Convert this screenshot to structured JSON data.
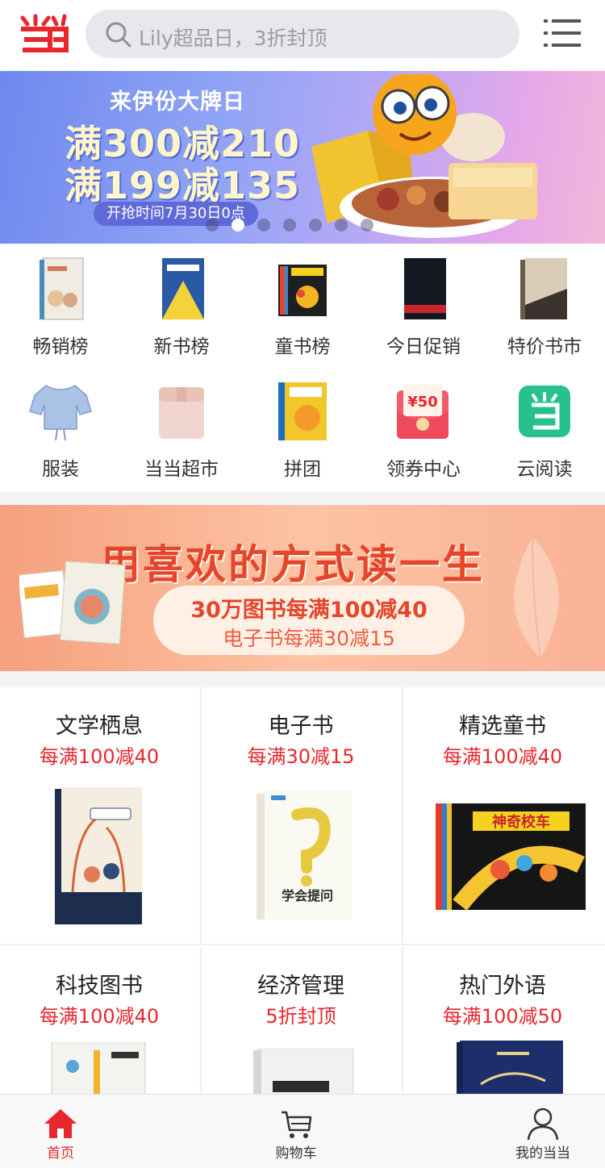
{
  "header": {
    "search_placeholder": "Lily超品日，3折封顶"
  },
  "hero": {
    "line1": "来伊份大牌日",
    "line2": "满300减210",
    "line3": "满199减135",
    "tag": "开抢时间7月30日0点",
    "slides": 7,
    "active_slide": 2
  },
  "categories": [
    {
      "label": "畅销榜"
    },
    {
      "label": "新书榜"
    },
    {
      "label": "童书榜"
    },
    {
      "label": "今日促销"
    },
    {
      "label": "特价书市"
    },
    {
      "label": "服装"
    },
    {
      "label": "当当超市"
    },
    {
      "label": "拼团"
    },
    {
      "label": "领券中心",
      "badge": "¥50"
    },
    {
      "label": "云阅读"
    }
  ],
  "promo": {
    "headline": "用喜欢的方式读一生",
    "line1": "30万图书每满100减40",
    "line2": "电子书每满30减15"
  },
  "sections": [
    {
      "title": "文学栖息",
      "offer": "每满100减40"
    },
    {
      "title": "电子书",
      "offer": "每满30减15",
      "cover_text": "学会提问"
    },
    {
      "title": "精选童书",
      "offer": "每满100减40",
      "cover_text": "神奇校车"
    },
    {
      "title": "科技图书",
      "offer": "每满100减40"
    },
    {
      "title": "经济管理",
      "offer": "5折封顶"
    },
    {
      "title": "热门外语",
      "offer": "每满100减50"
    }
  ],
  "tabbar": [
    {
      "label": "首页",
      "active": true
    },
    {
      "label": "购物车",
      "active": false
    },
    {
      "label": "我的当当",
      "active": false
    }
  ],
  "colors": {
    "brand_red": "#e8262e",
    "search_bg": "#e6e8ed",
    "promo_red": "#e5452a"
  }
}
